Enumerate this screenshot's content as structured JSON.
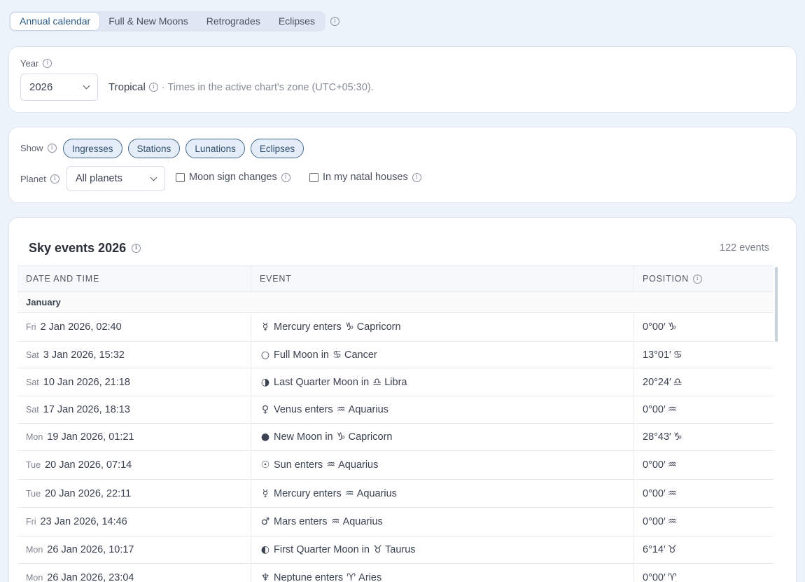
{
  "tabs": [
    {
      "label": "Annual calendar",
      "active": true
    },
    {
      "label": "Full & New Moons",
      "active": false
    },
    {
      "label": "Retrogrades",
      "active": false
    },
    {
      "label": "Eclipses",
      "active": false
    }
  ],
  "year_card": {
    "year_label": "Year",
    "year_value": "2026",
    "zodiac": "Tropical",
    "timezone_note": "· Times in the active chart's zone (UTC+05:30)."
  },
  "filter_card": {
    "show_label": "Show",
    "chips": [
      "Ingresses",
      "Stations",
      "Lunations",
      "Eclipses"
    ],
    "planet_label": "Planet",
    "planet_value": "All planets",
    "moon_sign_label": "Moon sign changes",
    "natal_houses_label": "In my natal houses"
  },
  "sky": {
    "title": "Sky events 2026",
    "count": "122 events",
    "headers": {
      "date": "DATE AND TIME",
      "event": "EVENT",
      "position": "POSITION"
    },
    "month": "January",
    "rows": [
      {
        "dow": "Fri",
        "date": "2 Jan 2026, 02:40",
        "glyph": "☿",
        "event_pre": "Mercury enters",
        "sign": "♑",
        "sign_name": "Capricorn",
        "pos": "0°00′",
        "h": 41
      },
      {
        "dow": "Sat",
        "date": "3 Jan 2026, 15:32",
        "glyph": "○",
        "event_pre": "Full Moon in",
        "sign": "♋",
        "sign_name": "Cancer",
        "pos": "13°01′",
        "h": 38
      },
      {
        "dow": "Sat",
        "date": "10 Jan 2026, 21:18",
        "glyph": "◑",
        "event_pre": "Last Quarter Moon in",
        "sign": "♎",
        "sign_name": "Libra",
        "pos": "20°24′",
        "h": 40
      },
      {
        "dow": "Sat",
        "date": "17 Jan 2026, 18:13",
        "glyph": "♀",
        "event_pre": "Venus enters",
        "sign": "♒",
        "sign_name": "Aquarius",
        "pos": "0°00′",
        "h": 39
      },
      {
        "dow": "Mon",
        "date": "19 Jan 2026, 01:21",
        "glyph": "●",
        "event_pre": "New Moon in",
        "sign": "♑",
        "sign_name": "Capricorn",
        "pos": "28°43′",
        "h": 39
      },
      {
        "dow": "Tue",
        "date": "20 Jan 2026, 07:14",
        "glyph": "☉",
        "event_pre": "Sun enters",
        "sign": "♒",
        "sign_name": "Aquarius",
        "pos": "0°00′",
        "h": 41
      },
      {
        "dow": "Tue",
        "date": "20 Jan 2026, 22:11",
        "glyph": "☿",
        "event_pre": "Mercury enters",
        "sign": "♒",
        "sign_name": "Aquarius",
        "pos": "0°00′",
        "h": 40
      },
      {
        "dow": "Fri",
        "date": "23 Jan 2026, 14:46",
        "glyph": "♂",
        "event_pre": "Mars enters",
        "sign": "♒",
        "sign_name": "Aquarius",
        "pos": "0°00′",
        "h": 41
      },
      {
        "dow": "Mon",
        "date": "26 Jan 2026, 10:17",
        "glyph": "◐",
        "event_pre": "First Quarter Moon in",
        "sign": "♉",
        "sign_name": "Taurus",
        "pos": "6°14′",
        "h": 39
      },
      {
        "dow": "Mon",
        "date": "26 Jan 2026, 23:04",
        "glyph": "♆",
        "event_pre": "Neptune enters",
        "sign": "♈",
        "sign_name": "Aries",
        "pos": "0°00′",
        "h": 40
      }
    ]
  }
}
